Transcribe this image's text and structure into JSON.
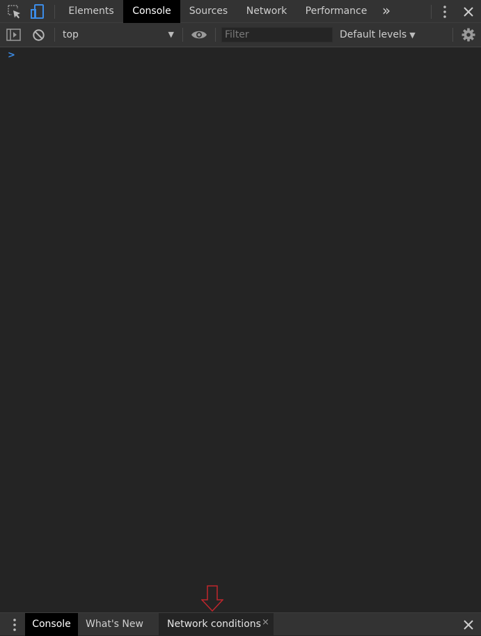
{
  "top_tabs": {
    "elements": "Elements",
    "console": "Console",
    "sources": "Sources",
    "network": "Network",
    "performance": "Performance",
    "more": "»"
  },
  "toolbar": {
    "context": "top",
    "filter_placeholder": "Filter",
    "levels": "Default levels"
  },
  "console": {
    "prompt": ">"
  },
  "drawer": {
    "tabs": [
      {
        "label": "Console",
        "active": true
      },
      {
        "label": "What's New",
        "active": false
      },
      {
        "label": "Network conditions",
        "active": false,
        "closable": true
      }
    ],
    "close_glyph": "×"
  },
  "colors": {
    "background": "#242424",
    "toolbar": "#333333",
    "active_tab": "#000000",
    "accent_blue": "#3c8ce7",
    "annotation_arrow": "#c0262d"
  },
  "icons": [
    "inspect-element-icon",
    "device-toolbar-icon",
    "more-options-icon",
    "close-icon",
    "sidebar-toggle-icon",
    "clear-console-icon",
    "eye-icon",
    "gear-icon",
    "drawer-menu-icon"
  ]
}
